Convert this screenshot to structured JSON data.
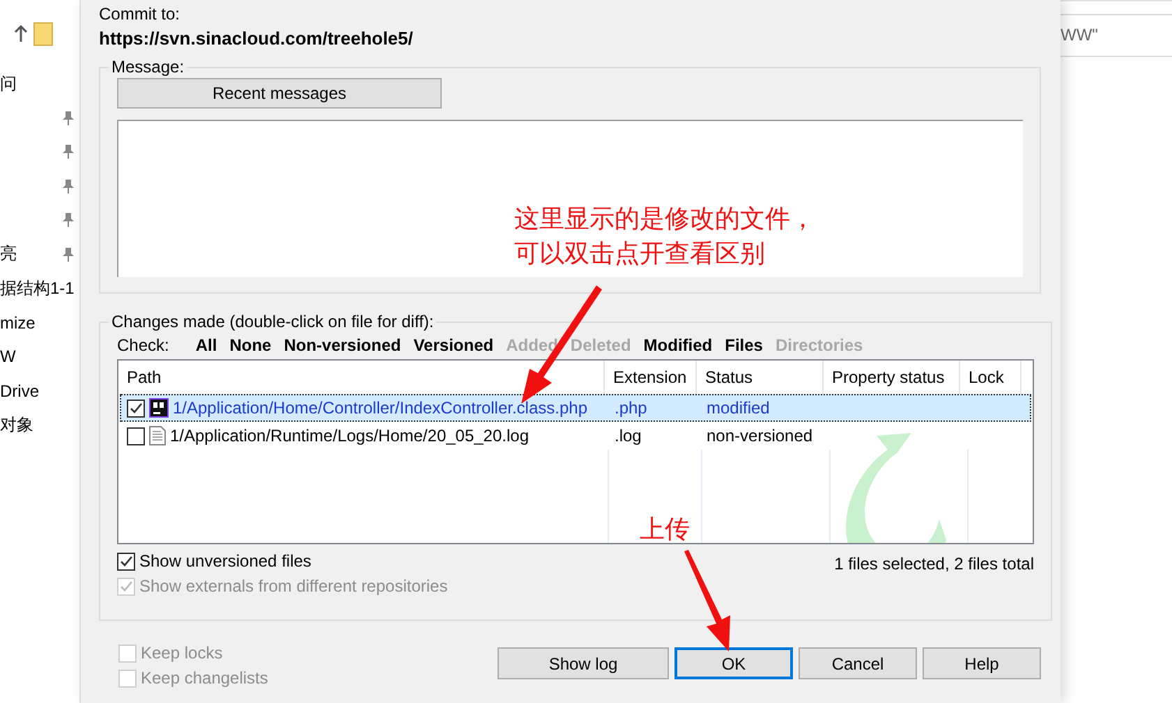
{
  "background_explorer": {
    "left_items": [
      {
        "text": "问",
        "pinned": false
      },
      {
        "pinned": true
      },
      {
        "pinned": true
      },
      {
        "pinned": true
      },
      {
        "pinned": true
      },
      {
        "text": "亮",
        "pinned": true
      },
      {
        "text": "据结构1-1",
        "pinned": false
      },
      {
        "text": "mize",
        "pinned": false
      },
      {
        "text": "W",
        "pinned": false
      },
      {
        "text": "Drive",
        "pinned": false
      },
      {
        "text": "对象",
        "pinned": false
      }
    ],
    "right_fragment": "WW\""
  },
  "commit_to": {
    "label": "Commit to:",
    "url": "https://svn.sinacloud.com/treehole5/"
  },
  "message": {
    "label": "Message:",
    "recent_button": "Recent messages"
  },
  "changes": {
    "label": "Changes made (double-click on file for diff):",
    "check_label": "Check:",
    "filters": [
      {
        "label": "All",
        "disabled": false
      },
      {
        "label": "None",
        "disabled": false
      },
      {
        "label": "Non-versioned",
        "disabled": false
      },
      {
        "label": "Versioned",
        "disabled": false
      },
      {
        "label": "Added",
        "disabled": true
      },
      {
        "label": "Deleted",
        "disabled": true
      },
      {
        "label": "Modified",
        "disabled": false
      },
      {
        "label": "Files",
        "disabled": false
      },
      {
        "label": "Directories",
        "disabled": true
      }
    ],
    "columns": [
      "Path",
      "Extension",
      "Status",
      "Property status",
      "Lock"
    ],
    "rows": [
      {
        "kind": "php",
        "path": "1/Application/Home/Controller/IndexController.class.php",
        "extension": ".php",
        "status": "modified",
        "checked": true,
        "selected": true
      },
      {
        "kind": "text",
        "path": "1/Application/Runtime/Logs/Home/20_05_20.log",
        "extension": ".log",
        "status": "non-versioned",
        "checked": false,
        "selected": false
      }
    ],
    "show_unversioned": {
      "label": "Show unversioned files",
      "checked": true,
      "disabled": false
    },
    "show_externals": {
      "label": "Show externals from different repositories",
      "checked": true,
      "disabled": true
    },
    "summary": "1 files selected, 2 files total"
  },
  "options": [
    {
      "label": "Keep locks",
      "checked": false,
      "disabled": true
    },
    {
      "label": "Keep changelists",
      "checked": false,
      "disabled": true
    }
  ],
  "buttons": [
    {
      "label": "Show log",
      "selected": false
    },
    {
      "label": "OK",
      "selected": true
    },
    {
      "label": "Cancel",
      "selected": false
    },
    {
      "label": "Help",
      "selected": false
    }
  ],
  "annotations": [
    {
      "text": "这里显示的是修改的文件，可以双击点开查看区别"
    },
    {
      "text": "上传"
    }
  ]
}
